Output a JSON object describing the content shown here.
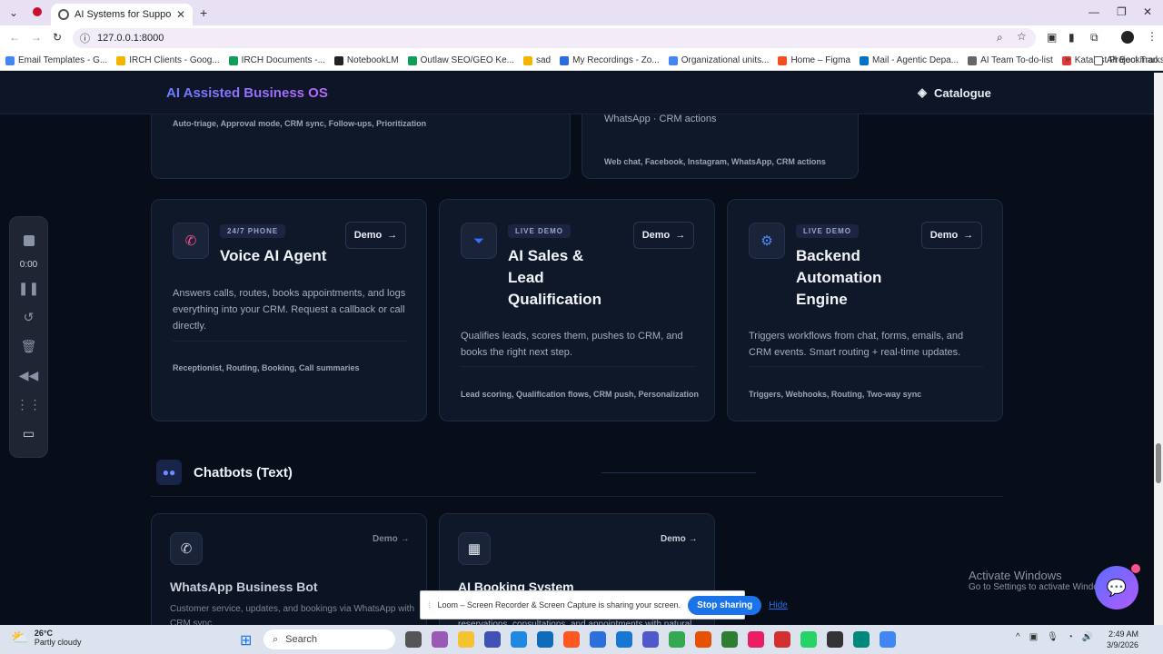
{
  "browser": {
    "tab_title": "AI Systems for Support, Sales, a",
    "url": "127.0.0.1:8000",
    "bookmarks": [
      "Email Templates - G...",
      "IRCH Clients - Goog...",
      "IRCH Documents -...",
      "NotebookLM",
      "Outlaw SEO/GEO Ke...",
      "sad",
      "My Recordings - Zo...",
      "Organizational units...",
      "Home – Figma",
      "Mail - Agentic Depa...",
      "AI Team To-do-list",
      "Katalyst Project Trac..."
    ],
    "all_bookmarks": "All Bookmarks"
  },
  "navbar": {
    "brand": "AI Assisted Business OS",
    "catalogue": "Catalogue"
  },
  "top_partial": {
    "left_tags": "Auto-triage, Approval mode, CRM sync, Follow-ups, Prioritization",
    "right_desc": "WhatsApp · CRM actions",
    "right_tags": "Web chat, Facebook, Instagram, WhatsApp, CRM actions"
  },
  "cards": [
    {
      "badge": "24/7 PHONE",
      "title": "Voice AI Agent",
      "demo": "Demo",
      "desc": "Answers calls, routes, books appointments, and logs everything into your CRM. Request a callback or call directly.",
      "tags": "Receptionist, Routing, Booking, Call summaries"
    },
    {
      "badge": "LIVE DEMO",
      "title": "AI Sales & Lead Qualification",
      "demo": "Demo",
      "desc": "Qualifies leads, scores them, pushes to CRM, and books the right next step.",
      "tags": "Lead scoring, Qualification flows, CRM push, Personalization"
    },
    {
      "badge": "LIVE DEMO",
      "title": "Backend Automation Engine",
      "demo": "Demo",
      "desc": "Triggers workflows from chat, forms, emails, and CRM events. Smart routing + real-time updates.",
      "tags": "Triggers, Webhooks, Routing, Two-way sync"
    }
  ],
  "section": {
    "title": "Chatbots (Text)"
  },
  "bots": [
    {
      "title": "WhatsApp Business Bot",
      "demo": "Demo",
      "desc": "Customer service, updates, and bookings via WhatsApp with CRM sync."
    },
    {
      "title": "AI Booking System",
      "demo": "Demo",
      "desc": "reservations, consultations, and appointments with natural"
    }
  ],
  "loom": {
    "time": "0:00"
  },
  "activate": {
    "line1": "Activate Windows",
    "line2": "Go to Settings to activate Windows."
  },
  "sharebar": {
    "text": "Loom – Screen Recorder & Screen Capture is sharing your screen.",
    "stop": "Stop sharing",
    "hide": "Hide"
  },
  "taskbar": {
    "temp": "26°C",
    "weather": "Partly cloudy",
    "search": "Search",
    "time": "2:49 AM",
    "date": "3/9/2026"
  },
  "colors": {
    "accent": "#6d7cff",
    "brand_gradient_end": "#b868ff",
    "page_bg": "#070d19",
    "card_bg": "#0f1829"
  }
}
